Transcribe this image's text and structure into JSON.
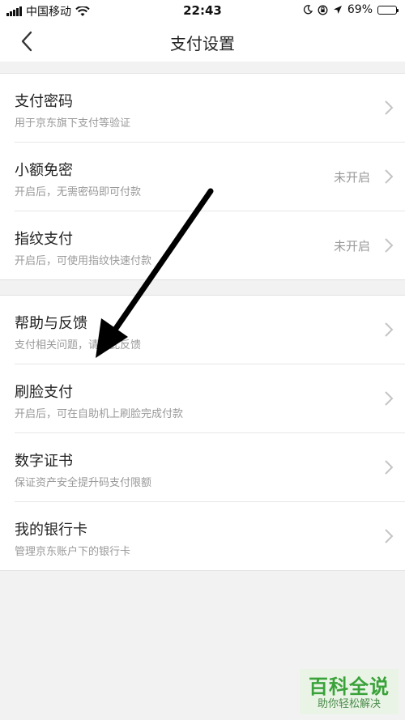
{
  "status_bar": {
    "carrier": "中国移动",
    "time": "22:43",
    "battery": "69%",
    "battery_level": 0.69,
    "icons": [
      "signal-icon",
      "wifi-icon",
      "moon-icon",
      "orientation-lock-icon",
      "location-arrow-icon",
      "battery-icon"
    ]
  },
  "nav": {
    "title": "支付设置",
    "back_icon": "chevron-left-icon"
  },
  "groups": [
    {
      "items": [
        {
          "title": "支付密码",
          "subtitle": "用于京东旗下支付等验证",
          "status": ""
        },
        {
          "title": "小额免密",
          "subtitle": "开启后，无需密码即可付款",
          "status": "未开启"
        },
        {
          "title": "指纹支付",
          "subtitle": "开启后，可使用指纹快速付款",
          "status": "未开启"
        }
      ]
    },
    {
      "items": [
        {
          "title": "帮助与反馈",
          "subtitle": "支付相关问题，请点此反馈",
          "status": ""
        },
        {
          "title": "刷脸支付",
          "subtitle": "开启后，可在自助机上刷脸完成付款",
          "status": ""
        },
        {
          "title": "数字证书",
          "subtitle": "保证资产安全提升码支付限额",
          "status": ""
        },
        {
          "title": "我的银行卡",
          "subtitle": "管理京东账户下的银行卡",
          "status": ""
        }
      ]
    }
  ],
  "watermark": {
    "main": "百科全说",
    "sub": "助你轻松解决"
  },
  "colors": {
    "background": "#f2f2f2",
    "row_background": "#ffffff",
    "subtitle": "#999999",
    "watermark_green": "#3aa23a"
  }
}
